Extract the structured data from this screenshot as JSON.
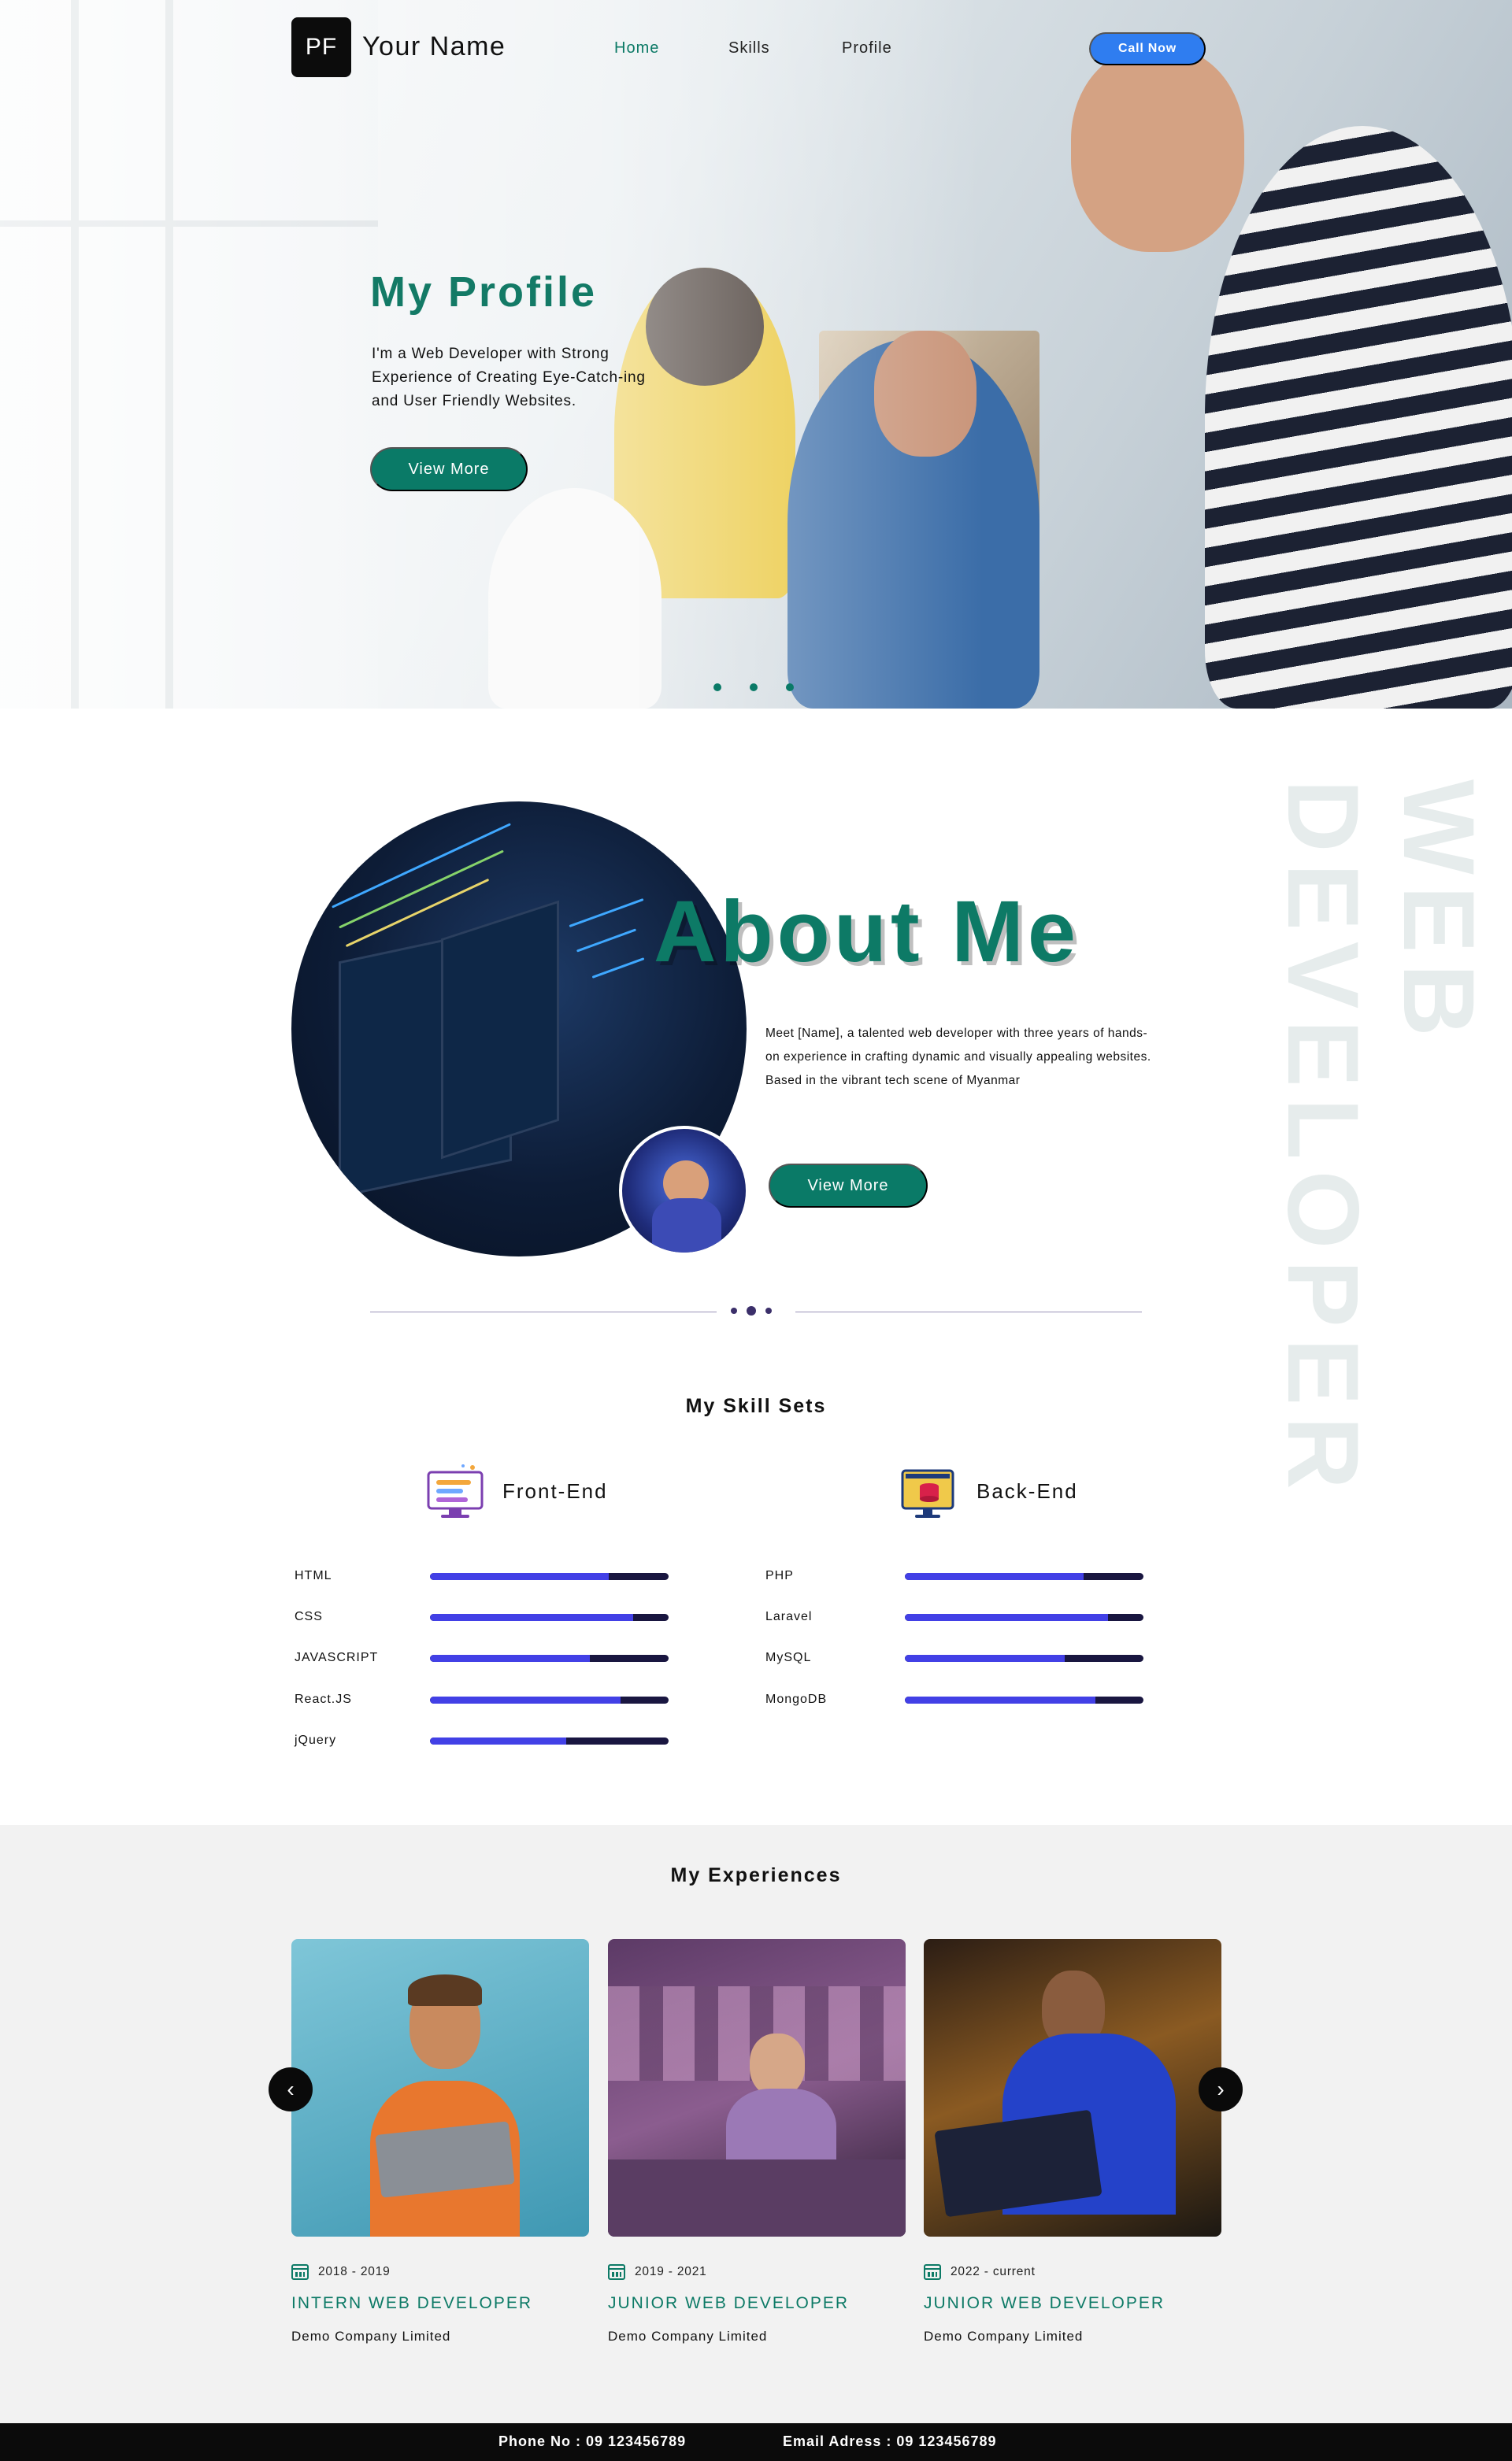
{
  "nav": {
    "logo_initials": "PF",
    "brand_name": "Your Name",
    "links": [
      "Home",
      "Skills",
      "Profile"
    ],
    "active_link": "Home",
    "cta_label": "Call Now"
  },
  "hero": {
    "title": "My Profile",
    "description": "I'm a Web Developer with Strong Experience of Creating Eye-Catch-ing and User Friendly Websites.",
    "button_label": "View More",
    "carousel_dots": 3
  },
  "about": {
    "vertical_text": "WEB DEVELOPER",
    "title": "About Me",
    "description": "Meet [Name], a talented web developer with three years of hands-on experience in crafting dynamic and visually appealing websites. Based in the vibrant tech scene of Myanmar",
    "button_label": "View More"
  },
  "skills": {
    "title": "My Skill Sets",
    "groups": [
      {
        "name": "Front-End",
        "icon": "monitor-icon",
        "items": [
          {
            "name": "HTML",
            "level": 0.75
          },
          {
            "name": "CSS",
            "level": 0.85
          },
          {
            "name": "JAVASCRIPT",
            "level": 0.67
          },
          {
            "name": "React.JS",
            "level": 0.8
          },
          {
            "name": "jQuery",
            "level": 0.57
          }
        ]
      },
      {
        "name": "Back-End",
        "icon": "server-database-icon",
        "items": [
          {
            "name": "PHP",
            "level": 0.75
          },
          {
            "name": "Laravel",
            "level": 0.85
          },
          {
            "name": "MySQL",
            "level": 0.67
          },
          {
            "name": "MongoDB",
            "level": 0.8
          }
        ]
      }
    ]
  },
  "experiences": {
    "title": "My Experiences",
    "items": [
      {
        "date": "2018 - 2019",
        "role": "INTERN WEB DEVELOPER",
        "company": "Demo Company Limited"
      },
      {
        "date": "2019 - 2021",
        "role": "JUNIOR WEB DEVELOPER",
        "company": "Demo Company Limited"
      },
      {
        "date": "2022 - current",
        "role": "JUNIOR WEB DEVELOPER",
        "company": "Demo Company Limited"
      }
    ],
    "prev_icon": "chevron-left-icon",
    "next_icon": "chevron-right-icon"
  },
  "footer": {
    "phone": "Phone No : 09 123456789",
    "email": "Email Adress : 09 123456789"
  },
  "colors": {
    "accent_teal": "#0a7a67",
    "cta_blue": "#2f7df0",
    "skill_fill": "#4240e6",
    "skill_track": "#191640",
    "footer_bg": "#0b0b0b"
  }
}
